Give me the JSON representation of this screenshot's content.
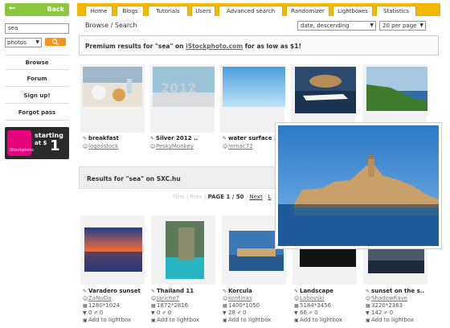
{
  "sidebar": {
    "back_label": "Back",
    "search_value": "sea",
    "type_select": "photos",
    "nav": [
      "Browse",
      "Forum",
      "Sign up!",
      "Forgot pass"
    ],
    "promo": {
      "brand": "iStockphoto",
      "line1": "starting",
      "line2": "at $",
      "price": "1"
    }
  },
  "tabs": [
    "Home",
    "Blogs",
    "Tutorials",
    "Users",
    "Advanced search",
    "Randomizer",
    "Lightboxes",
    "Statistics"
  ],
  "header": {
    "title": "Browse / Search",
    "sort": "date, descending",
    "per_page": "20 per page"
  },
  "premium": {
    "pre": "Premium results for \"sea\" on ",
    "link": "iStockphoto.com",
    "post": " for as low as $1!"
  },
  "premium_items": [
    {
      "title": "breakfast",
      "user": "logosstock"
    },
    {
      "title": "Silver 2012 ..",
      "user": "PeskyMonkey"
    },
    {
      "title": "water surface ..",
      "user": "mmac72"
    }
  ],
  "sxc": {
    "heading": "Results for \"sea\" on SXC.hu"
  },
  "pager": {
    "first": "First",
    "prev": "Prev",
    "page": "PAGE 1 / 50",
    "next": "Next",
    "last": "L"
  },
  "results": [
    {
      "title": "Varadero sunset",
      "user": "ZaNuDa",
      "size": "1280*1024",
      "count": "0",
      "likes": "0",
      "lightbox": "Add to lightbox"
    },
    {
      "title": "Thailand 11",
      "user": "Jaricho7",
      "size": "1872*2816",
      "count": "0",
      "likes": "0",
      "lightbox": "Add to lightbox"
    },
    {
      "title": "Korcula",
      "user": "kontinas",
      "size": "1400*1050",
      "count": "28",
      "likes": "0",
      "lightbox": "Add to lightbox"
    },
    {
      "title": "Landscape",
      "user": "Labovski",
      "size": "5184*3456",
      "count": "66",
      "likes": "0",
      "lightbox": "Add to lightbox"
    },
    {
      "title": "sunset on the s..",
      "user": "ShadowRave",
      "size": "3220*2363",
      "count": "142",
      "likes": "0",
      "lightbox": "Add to lightbox"
    }
  ],
  "colors": {
    "accent": "#f5b800",
    "back": "#8cc63f",
    "go": "#f7941e",
    "promo": "#e6007e"
  }
}
